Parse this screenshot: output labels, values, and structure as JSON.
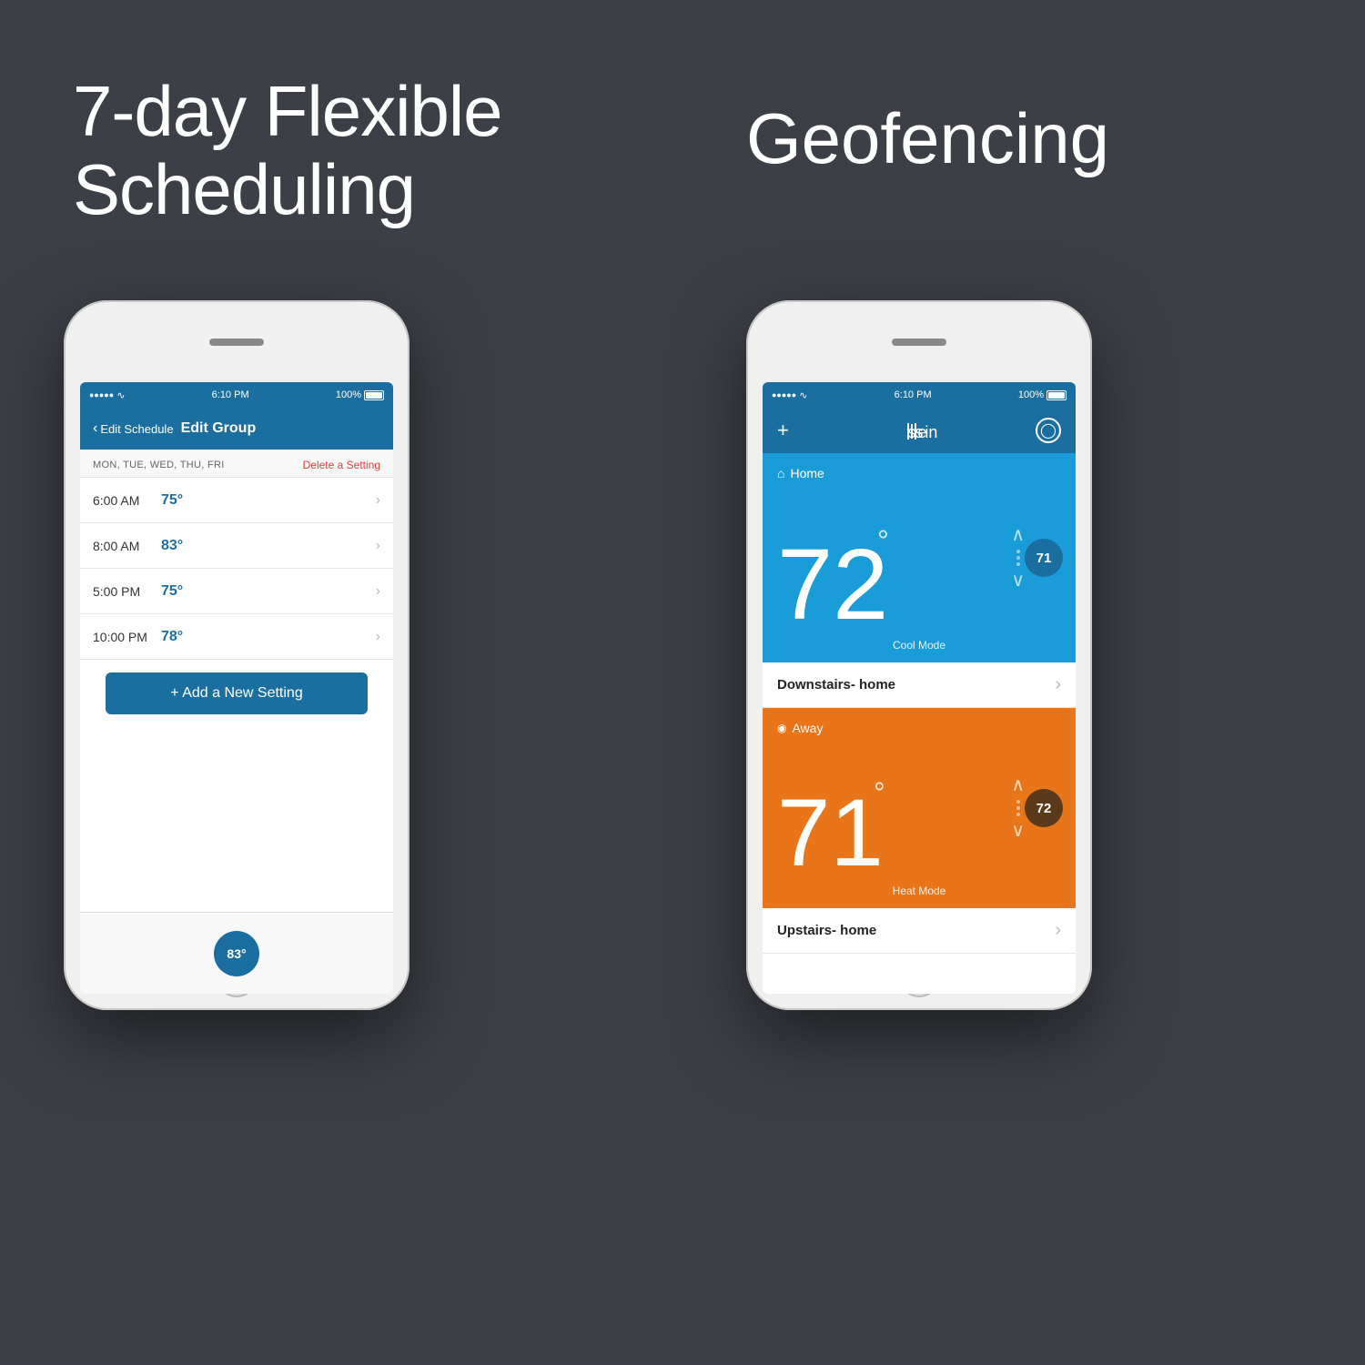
{
  "background": {
    "color": "#3c3f46"
  },
  "headline_left": {
    "line1": "7-day Flexible",
    "line2": "Scheduling"
  },
  "headline_right": {
    "text": "Geofencing"
  },
  "phone_left": {
    "status_bar": {
      "time": "6:10 PM",
      "battery": "100%",
      "signal_dots": 5,
      "wifi": true
    },
    "nav": {
      "back_label": "Edit Schedule",
      "title": "Edit Group"
    },
    "schedule": {
      "days": "MON, TUE, WED, THU, FRI",
      "delete_label": "Delete a Setting",
      "items": [
        {
          "time": "6:00 AM",
          "temp": "75°"
        },
        {
          "time": "8:00 AM",
          "temp": "83°"
        },
        {
          "time": "5:00 PM",
          "temp": "75°"
        },
        {
          "time": "10:00 PM",
          "temp": "78°"
        }
      ],
      "add_button": "+ Add a New Setting"
    },
    "bottom_circle_temp": "83°"
  },
  "phone_right": {
    "status_bar": {
      "time": "6:10 PM",
      "battery": "100%"
    },
    "nav": {
      "plus_label": "+",
      "logo": "sen|si",
      "user_icon": "person"
    },
    "cards": [
      {
        "id": "home",
        "label": "Home",
        "icon": "home",
        "big_temp": "72",
        "degree_symbol": "°",
        "set_temp": "71",
        "mode": "Cool Mode",
        "color": "#1a9cd8",
        "circle_color": "#1a6fa0"
      },
      {
        "id": "away",
        "label": "Away",
        "icon": "away",
        "big_temp": "71",
        "degree_symbol": "°",
        "set_temp": "72",
        "mode": "Heat Mode",
        "color": "#e8751a",
        "circle_color": "#5a3a1a"
      }
    ],
    "list_items": [
      {
        "name": "Downstairs- home",
        "chevron": "›"
      },
      {
        "name": "Upstairs- home",
        "chevron": "›"
      }
    ]
  }
}
